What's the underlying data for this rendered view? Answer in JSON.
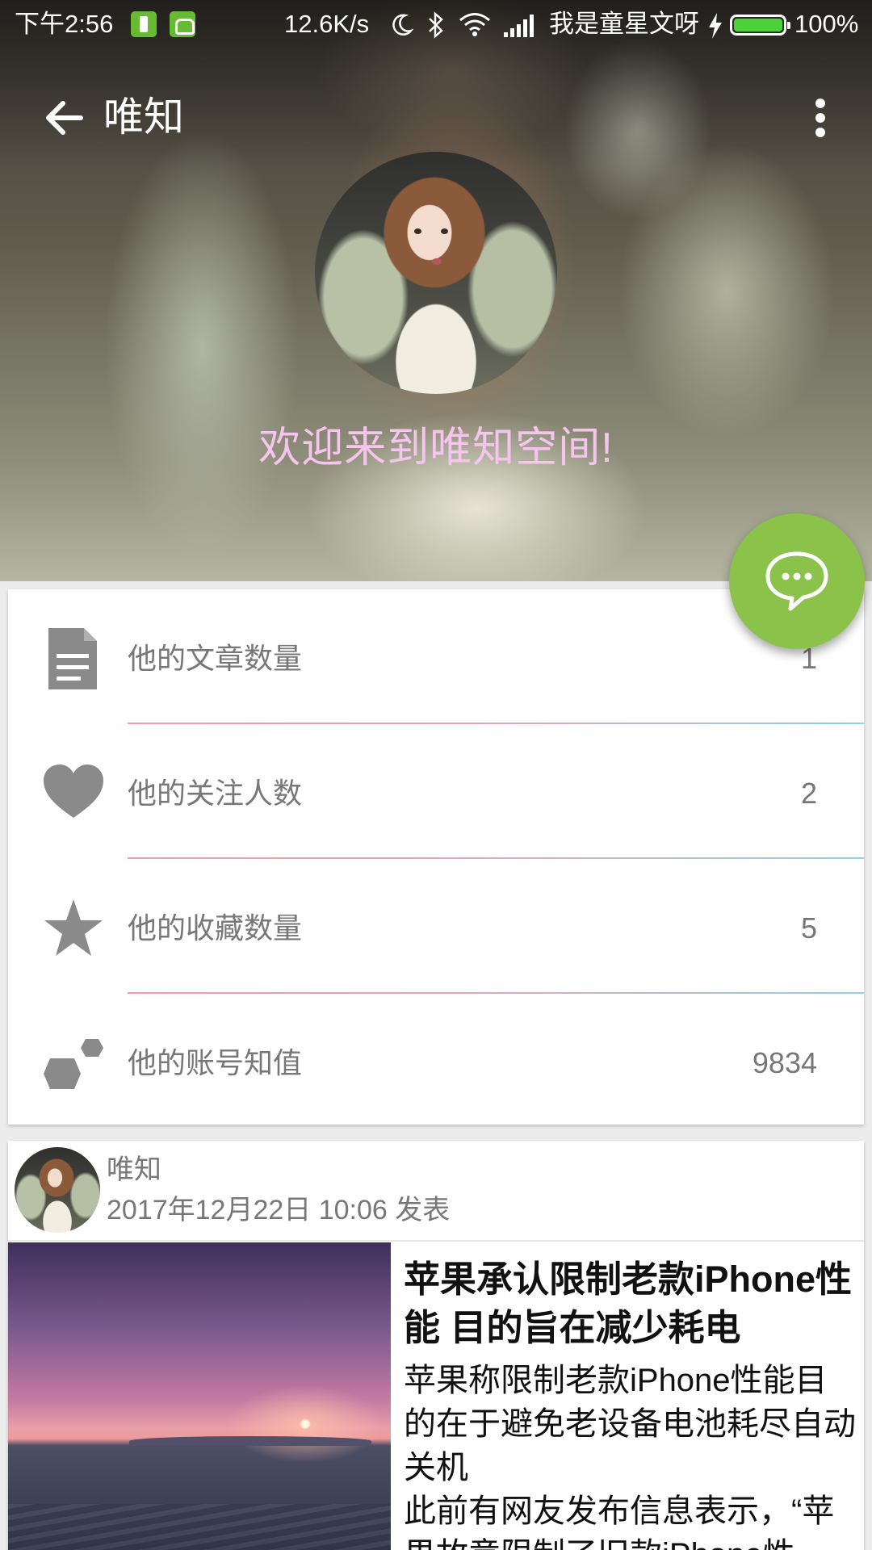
{
  "status_bar": {
    "time": "下午2:56",
    "net_speed": "12.6K/s",
    "carrier": "我是童星文呀",
    "battery": "100%",
    "icons": [
      "battery-saver-icon",
      "cat-icon",
      "moon-icon",
      "bluetooth-icon",
      "wifi-icon",
      "signal-icon",
      "charging-icon",
      "battery-icon"
    ]
  },
  "app_bar": {
    "title": "唯知",
    "back_icon": "arrow-left-icon",
    "menu_icon": "more-vertical-icon"
  },
  "profile": {
    "welcome": "欢迎来到唯知空间!"
  },
  "stats": [
    {
      "icon": "document-icon",
      "label": "他的文章数量",
      "value": "1"
    },
    {
      "icon": "heart-icon",
      "label": "他的关注人数",
      "value": "2"
    },
    {
      "icon": "star-icon",
      "label": "他的收藏数量",
      "value": "5"
    },
    {
      "icon": "hexagon-icon",
      "label": "他的账号知值",
      "value": "9834"
    }
  ],
  "fab": {
    "icon": "chat-bubble-icon"
  },
  "post": {
    "author": "唯知",
    "time": "2017年12月22日 10:06 发表",
    "title": "苹果承认限制老款iPhone性能 目的旨在减少耗电",
    "summary": "苹果称限制老款iPhone性能目的在于避免老设备电池耗尽自动关机",
    "summary_more": "此前有网友发布信息表示，“苹果故意限制了旧款iPhone性"
  },
  "colors": {
    "fab": "#8bc34a",
    "welcome_text": "#f5c5ee",
    "stat_text": "#777777",
    "divider_start": "#f39aa8",
    "divider_end": "#8fd3e0"
  }
}
